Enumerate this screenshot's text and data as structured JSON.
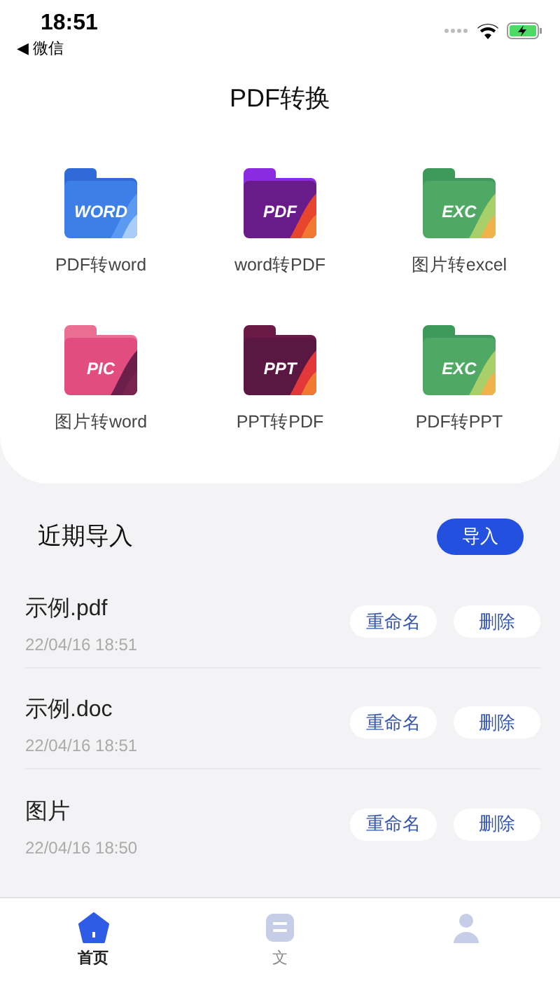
{
  "status_bar": {
    "time": "18:51",
    "back_label": "◀ 微信"
  },
  "header": {
    "title": "PDF转换"
  },
  "tools": [
    {
      "label": "PDF转word",
      "badge": "WORD",
      "kind": "word"
    },
    {
      "label": "word转PDF",
      "badge": "PDF",
      "kind": "pdf"
    },
    {
      "label": "图片转excel",
      "badge": "EXC",
      "kind": "excel"
    },
    {
      "label": "图片转word",
      "badge": "PIC",
      "kind": "pic"
    },
    {
      "label": "PPT转PDF",
      "badge": "PPT",
      "kind": "ppt"
    },
    {
      "label": "PDF转PPT",
      "badge": "EXC",
      "kind": "excel"
    }
  ],
  "recent": {
    "title": "近期导入",
    "import_button": "导入",
    "files": [
      {
        "name": "示例.pdf",
        "date": "22/04/16 18:51",
        "rename": "重命名",
        "delete": "删除"
      },
      {
        "name": "示例.doc",
        "date": "22/04/16 18:51",
        "rename": "重命名",
        "delete": "删除"
      },
      {
        "name": "图片",
        "date": "22/04/16 18:50",
        "rename": "重命名",
        "delete": "删除"
      }
    ]
  },
  "tab_bar": [
    {
      "label": "首页",
      "kind": "home",
      "selected": true
    },
    {
      "label": "文",
      "kind": "file",
      "selected": false
    },
    {
      "kind": "person",
      "selected": false
    }
  ]
}
